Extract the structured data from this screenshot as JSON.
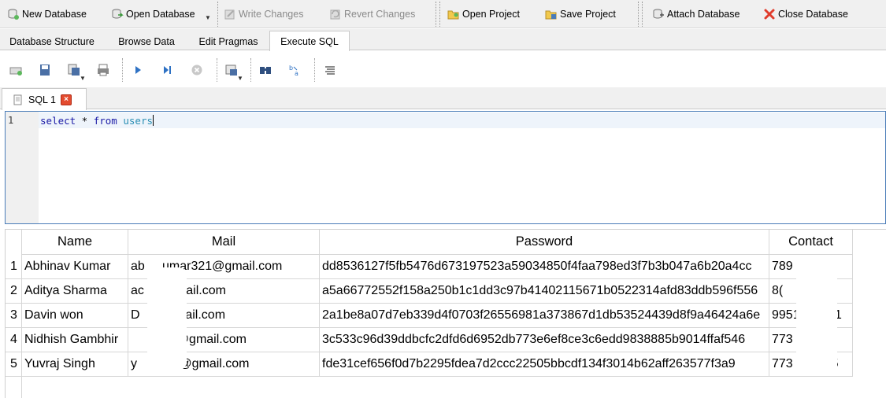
{
  "toolbar": {
    "new_database": "New Database",
    "open_database": "Open Database",
    "write_changes": "Write Changes",
    "revert_changes": "Revert Changes",
    "open_project": "Open Project",
    "save_project": "Save Project",
    "attach_database": "Attach Database",
    "close_database": "Close Database"
  },
  "tabs": [
    "Database Structure",
    "Browse Data",
    "Edit Pragmas",
    "Execute SQL"
  ],
  "active_tab": "Execute SQL",
  "sql_tab": {
    "label": "SQL 1"
  },
  "editor": {
    "line_number": "1",
    "kw1": "select",
    "star": " * ",
    "kw2": "from",
    "table": " users"
  },
  "results": {
    "columns": [
      "Name",
      "Mail",
      "Password",
      "Contact"
    ],
    "rows": [
      {
        "num": "1",
        "name": "Abhinav Kumar",
        "mail": "ab     umar321@gmail.com",
        "password": "dd8536127f5fb5476d673197523a59034850f4faa798ed3f7b3b047a6b20a4cc",
        "contact": "789       8"
      },
      {
        "num": "2",
        "name": "Aditya Sharma",
        "mail": "ac         mail.com",
        "password": "a5a66772552f158a250b1c1dd3c97b41402115671b0522314afd83ddb596f556",
        "contact": "8("
      },
      {
        "num": "3",
        "name": "Davin won",
        "mail": "D          crail.com",
        "password": "2a1be8a07d7eb339d4f0703f26556981a373867d1db53524439d8f9a46424a6e",
        "contact": "9951        61"
      },
      {
        "num": "4",
        "name": "Nidhish Gambhir",
        "mail": "           9@gmail.com",
        "password": "3c533c96d39ddbcfc2dfd6d6952db773e6ef8ce3c6edd9838885b9014ffaf546",
        "contact": "773        98"
      },
      {
        "num": "5",
        "name": "Yuvraj Singh",
        "mail": "y          3@gmail.com",
        "password": "fde31cef656f0d7b2295fdea7d2ccc22505bbcdf134f3014b62aff263577f3a9",
        "contact": "773       795"
      }
    ]
  },
  "colors": {
    "accent": "#4a7cb8",
    "keyword": "#1a1aa6",
    "identifier": "#2b8fb4",
    "close": "#e34b2f"
  }
}
